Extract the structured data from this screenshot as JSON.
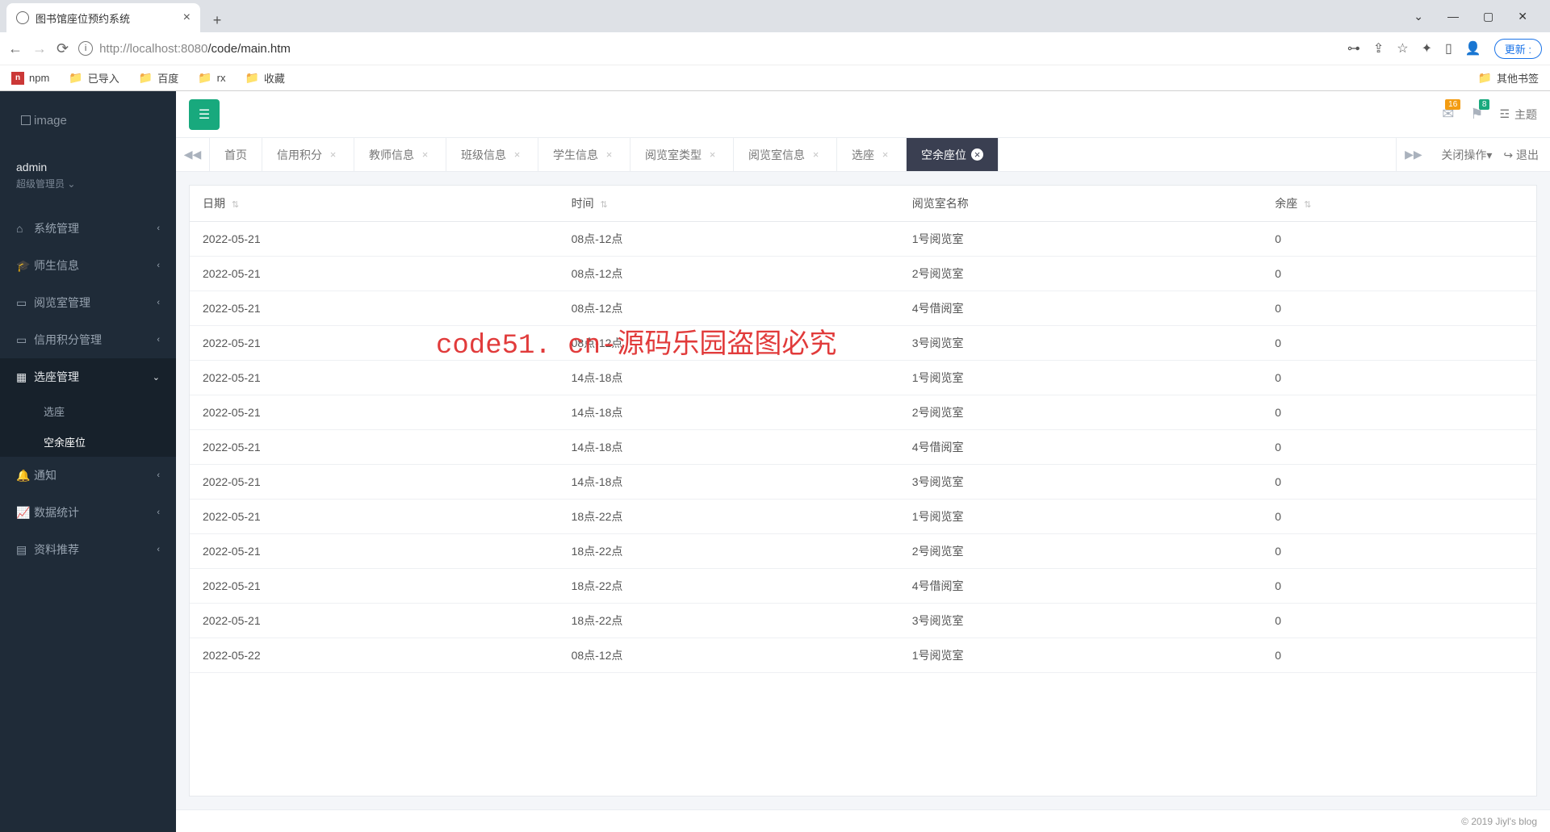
{
  "browser": {
    "tab_title": "图书馆座位预约系统",
    "url_host": "http://localhost",
    "url_port": ":8080",
    "url_path": "/code/main.htm",
    "update_btn": "更新 :",
    "bookmarks": [
      "npm",
      "已导入",
      "百度",
      "rx",
      "收藏"
    ],
    "other_bookmarks": "其他书签"
  },
  "sidebar": {
    "logo": "image",
    "user": {
      "name": "admin",
      "role": "超级管理员"
    },
    "items": [
      {
        "label": "系统管理",
        "icon": "home"
      },
      {
        "label": "师生信息",
        "icon": "grad"
      },
      {
        "label": "阅览室管理",
        "icon": "book"
      },
      {
        "label": "信用积分管理",
        "icon": "card"
      },
      {
        "label": "选座管理",
        "icon": "calendar",
        "expanded": true,
        "children": [
          {
            "label": "选座"
          },
          {
            "label": "空余座位",
            "active": true
          }
        ]
      },
      {
        "label": "通知",
        "icon": "bell"
      },
      {
        "label": "数据统计",
        "icon": "chart"
      },
      {
        "label": "资料推荐",
        "icon": "doc"
      }
    ]
  },
  "topbar": {
    "notif1_count": "16",
    "notif2_count": "8",
    "theme": "主题"
  },
  "tabs": {
    "items": [
      "首页",
      "信用积分",
      "教师信息",
      "班级信息",
      "学生信息",
      "阅览室类型",
      "阅览室信息",
      "选座",
      "空余座位"
    ],
    "active_index": 8,
    "close_ops": "关闭操作",
    "logout": "退出"
  },
  "table": {
    "headers": [
      "日期",
      "时间",
      "阅览室名称",
      "余座"
    ],
    "rows": [
      {
        "date": "2022-05-21",
        "time": "08点-12点",
        "room": "1号阅览室",
        "left": "0"
      },
      {
        "date": "2022-05-21",
        "time": "08点-12点",
        "room": "2号阅览室",
        "left": "0"
      },
      {
        "date": "2022-05-21",
        "time": "08点-12点",
        "room": "4号借阅室",
        "left": "0"
      },
      {
        "date": "2022-05-21",
        "time": "08点-12点",
        "room": "3号阅览室",
        "left": "0"
      },
      {
        "date": "2022-05-21",
        "time": "14点-18点",
        "room": "1号阅览室",
        "left": "0"
      },
      {
        "date": "2022-05-21",
        "time": "14点-18点",
        "room": "2号阅览室",
        "left": "0"
      },
      {
        "date": "2022-05-21",
        "time": "14点-18点",
        "room": "4号借阅室",
        "left": "0"
      },
      {
        "date": "2022-05-21",
        "time": "14点-18点",
        "room": "3号阅览室",
        "left": "0"
      },
      {
        "date": "2022-05-21",
        "time": "18点-22点",
        "room": "1号阅览室",
        "left": "0"
      },
      {
        "date": "2022-05-21",
        "time": "18点-22点",
        "room": "2号阅览室",
        "left": "0"
      },
      {
        "date": "2022-05-21",
        "time": "18点-22点",
        "room": "4号借阅室",
        "left": "0"
      },
      {
        "date": "2022-05-21",
        "time": "18点-22点",
        "room": "3号阅览室",
        "left": "0"
      },
      {
        "date": "2022-05-22",
        "time": "08点-12点",
        "room": "1号阅览室",
        "left": "0"
      }
    ]
  },
  "footer": "© 2019 Jiyl's blog",
  "watermark": "code51. cn-源码乐园盗图必究"
}
